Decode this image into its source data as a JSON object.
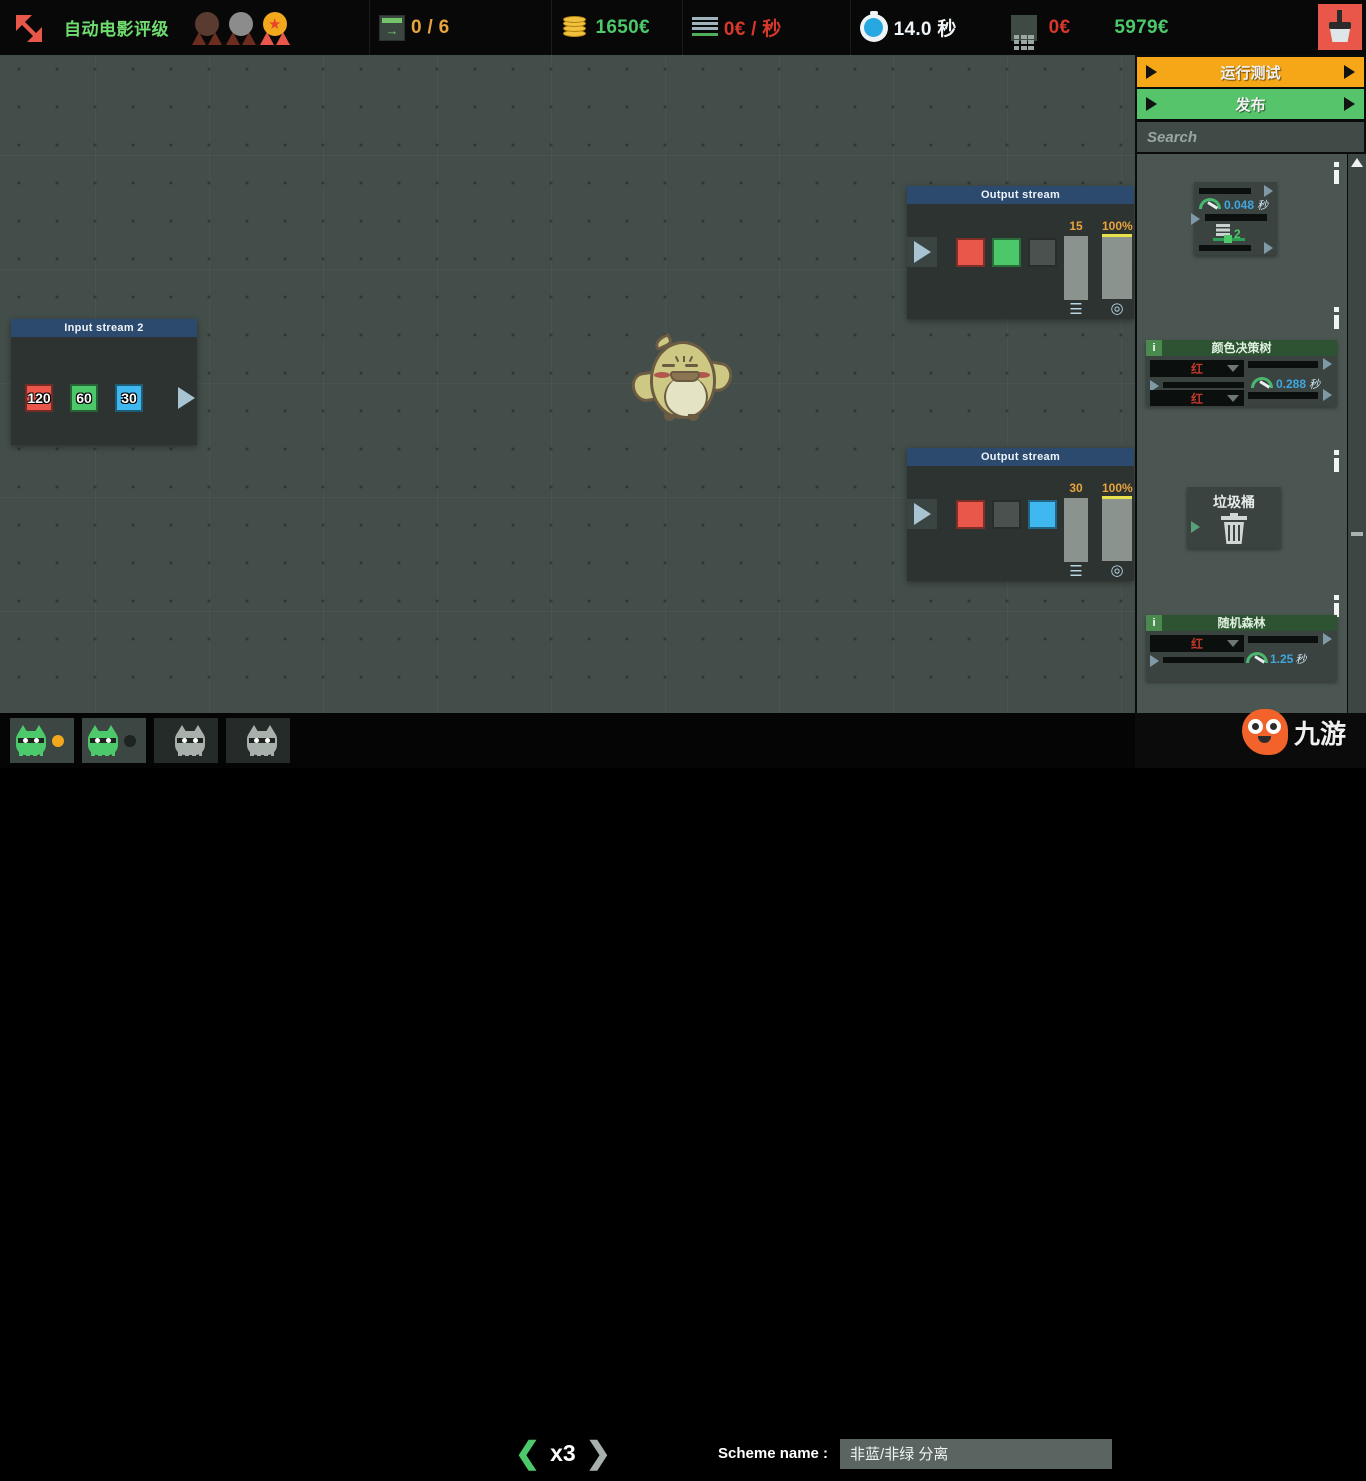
{
  "topbar": {
    "back_icon": "back-arrow-icon",
    "level_title": "自动电影评级",
    "medals": [
      {
        "name": "bronze-medal",
        "color": "#5a3b30",
        "earned": false
      },
      {
        "name": "silver-medal",
        "color": "#8c8c8c",
        "earned": false
      },
      {
        "name": "gold-medal",
        "color": "#f2a81d",
        "earned": true
      }
    ],
    "stats": [
      {
        "icon": "level-progress-icon",
        "value": "0 / 6",
        "color": "#e8a33c"
      },
      {
        "icon": "coins-icon",
        "value": "1650€",
        "color": "#4cc96a"
      },
      {
        "icon": "rate-bars-icon",
        "value": "0€ / 秒",
        "color": "#d6392c"
      },
      {
        "icon": "timer-icon",
        "value": "14.0 秒",
        "color": "#eef4f8"
      },
      {
        "icon": "calculator-icon",
        "value": "0€",
        "color": "#d6392c"
      },
      {
        "icon": "",
        "value": "5979€",
        "color": "#4cc96a"
      }
    ],
    "clear_button": "clear-broom-button"
  },
  "canvas": {
    "input_stream": {
      "title": "Input stream 2",
      "chips": [
        {
          "label": "120",
          "color": "#e8574a"
        },
        {
          "label": "60",
          "color": "#4cc86a"
        },
        {
          "label": "30",
          "color": "#3fb8f0"
        }
      ],
      "play": "play-button"
    },
    "output_streams": [
      {
        "title": "Output stream",
        "count": "15",
        "percent": "100%",
        "chips": [
          {
            "color": "#e8574a",
            "name": "red-chip"
          },
          {
            "color": "#4cc86a",
            "name": "green-chip"
          },
          {
            "color": "#4a524f",
            "name": "empty-chip"
          }
        ],
        "icons": [
          "layers-icon",
          "target-icon"
        ]
      },
      {
        "title": "Output stream",
        "count": "30",
        "percent": "100%",
        "chips": [
          {
            "color": "#e8574a",
            "name": "red-chip"
          },
          {
            "color": "#4a524f",
            "name": "empty-chip"
          },
          {
            "color": "#3fb8f0",
            "name": "blue-chip"
          }
        ],
        "icons": [
          "layers-icon",
          "target-icon"
        ]
      }
    ],
    "mascot": "bird-mascot"
  },
  "sidebar": {
    "run_test_label": "运行测试",
    "publish_label": "发布",
    "search_placeholder": "Search",
    "palette": [
      {
        "name": "timer-branch-node",
        "title": "",
        "time_value": "0.048",
        "time_unit": "秒",
        "count": "2"
      },
      {
        "name": "color-decision-tree-node",
        "title": "颜色决策树",
        "dropdown_top": "红",
        "dropdown_bottom": "红",
        "time_value": "0.288",
        "time_unit": "秒"
      },
      {
        "name": "trash-can-node",
        "title": "垃圾桶"
      },
      {
        "name": "random-forest-node",
        "title": "随机森林",
        "dropdown_top": "红",
        "time_value": "1.25",
        "time_unit": "秒"
      }
    ],
    "scrollbar": {
      "up": "scroll-up-arrow",
      "down": "scroll-down-arrow"
    }
  },
  "bottombar": {
    "cats": [
      {
        "name": "cat-slot-1",
        "active": true,
        "dot": "#f2a81d"
      },
      {
        "name": "cat-slot-2",
        "active": true,
        "dot": "#1e241f"
      },
      {
        "name": "cat-slot-3",
        "active": false,
        "dot": ""
      },
      {
        "name": "cat-slot-4",
        "active": false,
        "dot": ""
      }
    ],
    "speed": {
      "prev": "❮",
      "label": "x3",
      "next": "❯"
    },
    "scheme_label": "Scheme name :",
    "scheme_value": "非蓝/非绿 分离"
  },
  "watermark": {
    "text": "九游"
  },
  "colors": {
    "accent_orange": "#f5a718",
    "accent_green": "#56c46a",
    "canvas_bg": "#434d49",
    "panel_title_blue": "#2c4a6e"
  }
}
